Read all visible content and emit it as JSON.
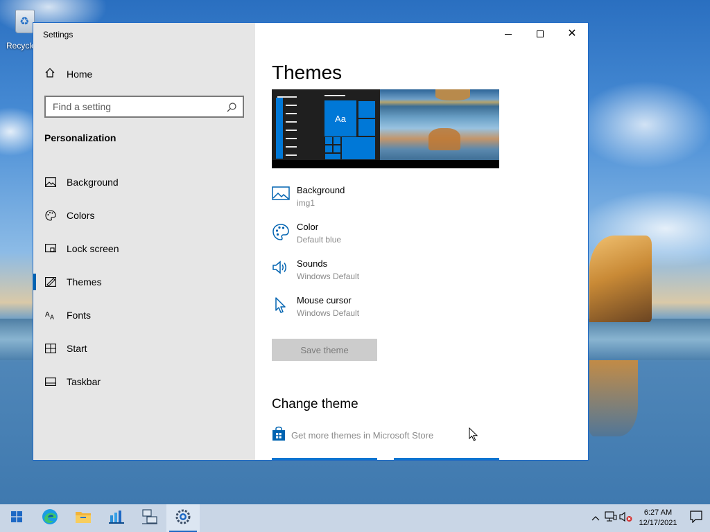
{
  "desktop": {
    "recycle_bin_label": "Recycle"
  },
  "window": {
    "title": "Settings",
    "controls": {
      "minimize": "minimize",
      "maximize": "maximize",
      "close": "✕"
    }
  },
  "sidebar": {
    "home_label": "Home",
    "search": {
      "placeholder": "Find a setting",
      "value": ""
    },
    "section_title": "Personalization",
    "items": [
      {
        "label": "Background",
        "icon": "image-icon"
      },
      {
        "label": "Colors",
        "icon": "palette-icon"
      },
      {
        "label": "Lock screen",
        "icon": "lock-screen-icon"
      },
      {
        "label": "Themes",
        "icon": "themes-icon",
        "active": true
      },
      {
        "label": "Fonts",
        "icon": "fonts-icon"
      },
      {
        "label": "Start",
        "icon": "start-icon"
      },
      {
        "label": "Taskbar",
        "icon": "taskbar-icon"
      }
    ]
  },
  "main": {
    "page_title": "Themes",
    "preview": {
      "tile_label": "Aa"
    },
    "properties": [
      {
        "name": "Background",
        "value": "img1",
        "icon": "image-icon"
      },
      {
        "name": "Color",
        "value": "Default blue",
        "icon": "palette-icon"
      },
      {
        "name": "Sounds",
        "value": "Windows Default",
        "icon": "speaker-icon"
      },
      {
        "name": "Mouse cursor",
        "value": "Windows Default",
        "icon": "cursor-icon"
      }
    ],
    "save_theme_label": "Save theme",
    "change_theme_title": "Change theme",
    "store_link_label": "Get more themes in Microsoft Store"
  },
  "taskbar": {
    "apps": [
      "start-icon",
      "edge-icon",
      "file-explorer-icon",
      "server-manager-icon",
      "network-icon",
      "settings-icon"
    ],
    "clock": {
      "time": "6:27 AM",
      "date": "12/17/2021"
    }
  },
  "colors": {
    "accent": "#0078d7",
    "sidebar_bg": "#e6e6e6",
    "taskbar_bg": "#c9d6e6"
  }
}
